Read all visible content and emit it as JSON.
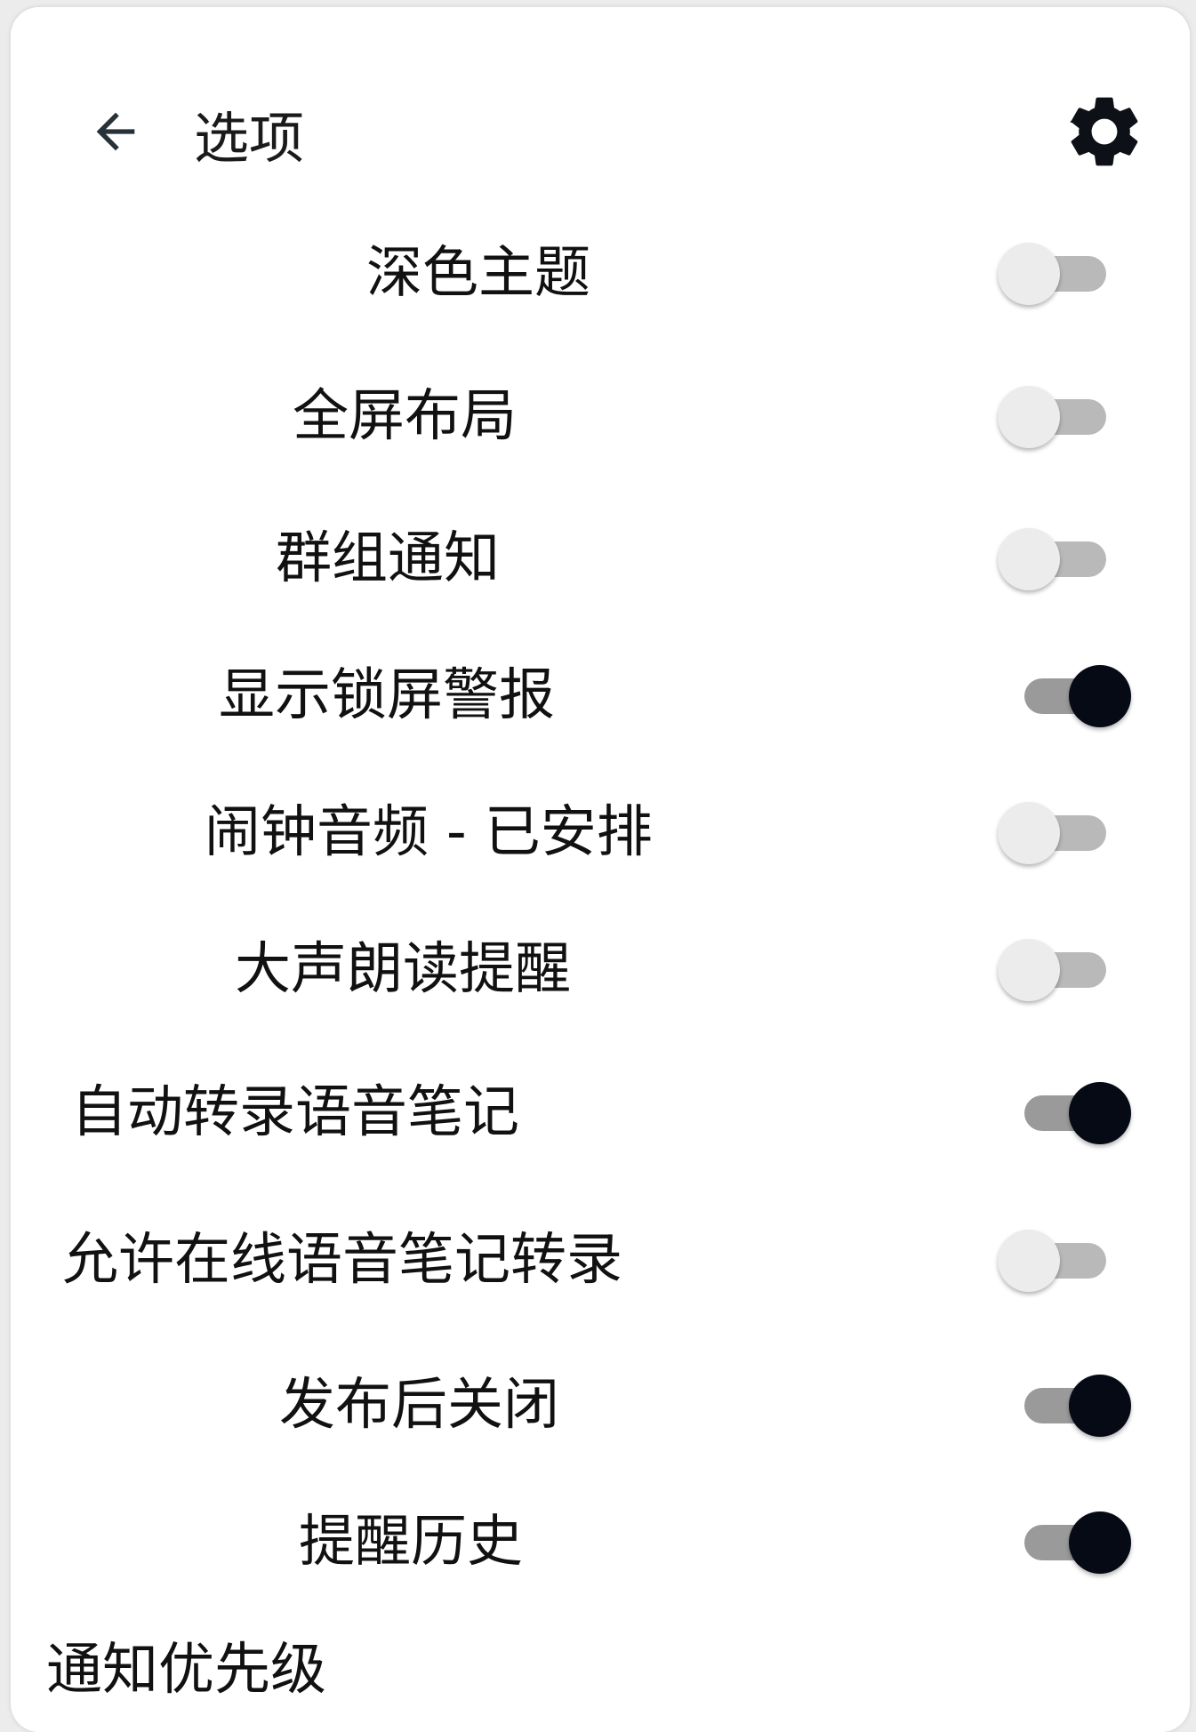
{
  "header": {
    "title": "选项"
  },
  "colors": {
    "switch_on_thumb": "#050a14",
    "switch_on_track": "#9a9a9a",
    "switch_off_thumb": "#ececec",
    "switch_off_track": "#b9b9b9"
  },
  "icons": {
    "back": "arrow-left-icon",
    "settings": "gear-icon"
  },
  "settings": [
    {
      "label": "深色主题",
      "enabled": false
    },
    {
      "label": "全屏布局",
      "enabled": false
    },
    {
      "label": "群组通知",
      "enabled": false
    },
    {
      "label": "显示锁屏警报",
      "enabled": true
    },
    {
      "label": "闹钟音频 - 已安排",
      "enabled": false
    },
    {
      "label": "大声朗读提醒",
      "enabled": false
    },
    {
      "label": "自动转录语音笔记",
      "enabled": true
    },
    {
      "label": "允许在线语音笔记转录",
      "enabled": false
    },
    {
      "label": "发布后关闭",
      "enabled": true
    },
    {
      "label": "提醒历史",
      "enabled": true
    },
    {
      "label": "通知优先级"
    }
  ]
}
